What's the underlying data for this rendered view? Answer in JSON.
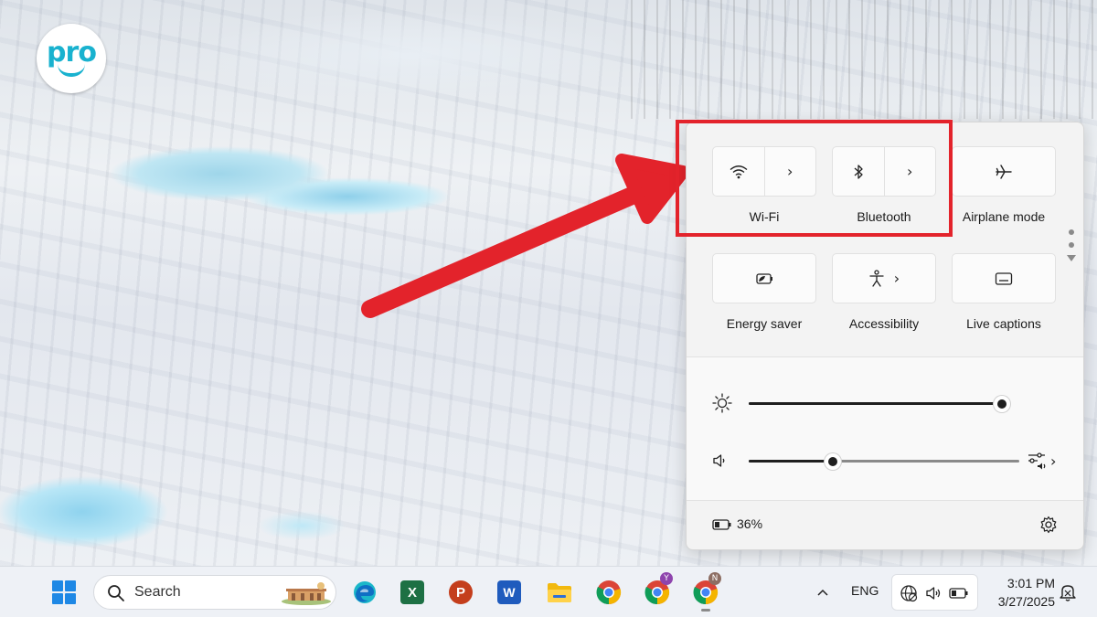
{
  "logo": {
    "text": "pro"
  },
  "quick_settings": {
    "tiles": [
      {
        "id": "wifi",
        "label": "Wi-Fi",
        "icon": "wifi-icon",
        "has_expander": true
      },
      {
        "id": "bluetooth",
        "label": "Bluetooth",
        "icon": "bluetooth-icon",
        "has_expander": true
      },
      {
        "id": "airplane",
        "label": "Airplane mode",
        "icon": "airplane-icon",
        "has_expander": false
      },
      {
        "id": "energy",
        "label": "Energy saver",
        "icon": "energy-saver-icon",
        "has_expander": false
      },
      {
        "id": "accessibility",
        "label": "Accessibility",
        "icon": "accessibility-icon",
        "has_expander": true
      },
      {
        "id": "captions",
        "label": "Live captions",
        "icon": "live-captions-icon",
        "has_expander": false
      }
    ],
    "brightness": {
      "icon": "brightness-icon",
      "level": 0.97
    },
    "volume": {
      "icon": "speaker-icon",
      "level": 0.31,
      "mixer_icon": "audio-mixer-icon"
    },
    "battery": {
      "icon": "battery-icon",
      "percent": "36%"
    },
    "settings_icon": "gear-icon"
  },
  "taskbar": {
    "start_icon": "windows-start-icon",
    "search": {
      "placeholder": "Search",
      "icon": "search-icon"
    },
    "apps": [
      {
        "name": "Microsoft Edge",
        "icon": "edge-icon"
      },
      {
        "name": "Excel",
        "icon": "excel-icon",
        "letter": "X"
      },
      {
        "name": "PowerPoint",
        "icon": "powerpoint-icon",
        "letter": "P"
      },
      {
        "name": "Word",
        "icon": "word-icon",
        "letter": "W"
      },
      {
        "name": "File Explorer",
        "icon": "folder-icon"
      },
      {
        "name": "Chrome",
        "icon": "chrome-icon"
      },
      {
        "name": "Chrome profile Y",
        "icon": "chrome-icon",
        "badge": "Y"
      },
      {
        "name": "Chrome profile N",
        "icon": "chrome-icon",
        "badge": "N"
      }
    ],
    "tray": {
      "overflow_icon": "chevron-up-icon",
      "language": "ENG",
      "network_icon": "globe-no-internet-icon",
      "volume_icon": "speaker-icon",
      "battery_icon": "battery-icon",
      "time": "3:01 PM",
      "date": "3/27/2025",
      "notification_icon": "notification-bell-icon"
    }
  },
  "colors": {
    "highlight": "#e3232b",
    "arrow": "#e3232b",
    "logo_accent": "#19b2cf",
    "panel_bg": "#f3f3f3"
  }
}
